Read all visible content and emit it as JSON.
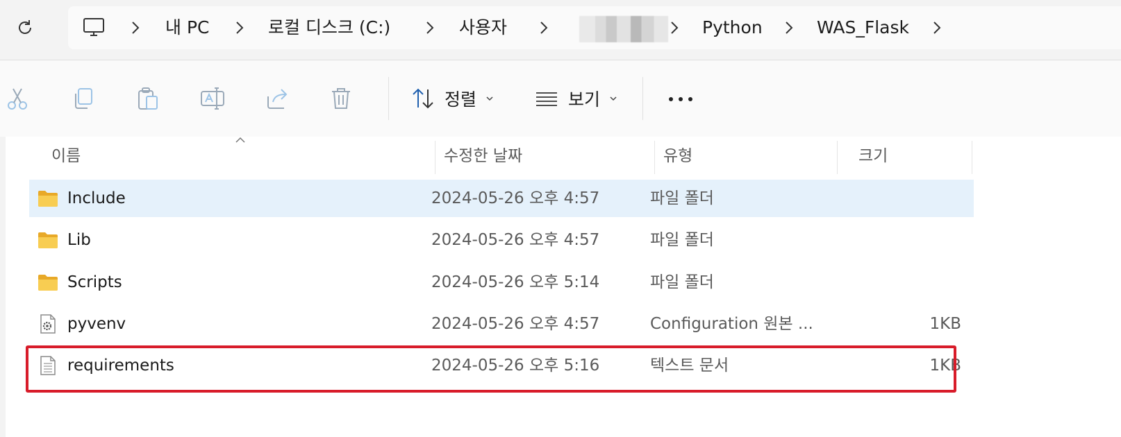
{
  "address_bar": {
    "crumbs": [
      "내 PC",
      "로컬 디스크 (C:)",
      "사용자",
      "Python",
      "WAS_Flask"
    ]
  },
  "toolbar": {
    "sort_label": "정렬",
    "view_label": "보기",
    "icons": [
      "cut-icon",
      "copy-icon",
      "paste-icon",
      "rename-icon",
      "share-icon",
      "delete-icon",
      "sort-icon",
      "view-icon",
      "more-icon"
    ]
  },
  "columns": {
    "name": "이름",
    "date": "수정한 날짜",
    "type": "유형",
    "size": "크기"
  },
  "files": [
    {
      "name": "Include",
      "date": "2024-05-26 오후 4:57",
      "type": "파일 폴더",
      "size": "",
      "icon": "folder-icon",
      "selected": true
    },
    {
      "name": "Lib",
      "date": "2024-05-26 오후 4:57",
      "type": "파일 폴더",
      "size": "",
      "icon": "folder-icon",
      "selected": false
    },
    {
      "name": "Scripts",
      "date": "2024-05-26 오후 5:14",
      "type": "파일 폴더",
      "size": "",
      "icon": "folder-icon",
      "selected": false
    },
    {
      "name": "pyvenv",
      "date": "2024-05-26 오후 4:57",
      "type": "Configuration 원본 ...",
      "size": "1KB",
      "icon": "config-file-icon",
      "selected": false
    },
    {
      "name": "requirements",
      "date": "2024-05-26 오후 5:16",
      "type": "텍스트 문서",
      "size": "1KB",
      "icon": "text-file-icon",
      "selected": false
    }
  ],
  "colors": {
    "selection": "#e5f1fb",
    "highlight_border": "#d81c2a",
    "folder": "#f6c343"
  }
}
